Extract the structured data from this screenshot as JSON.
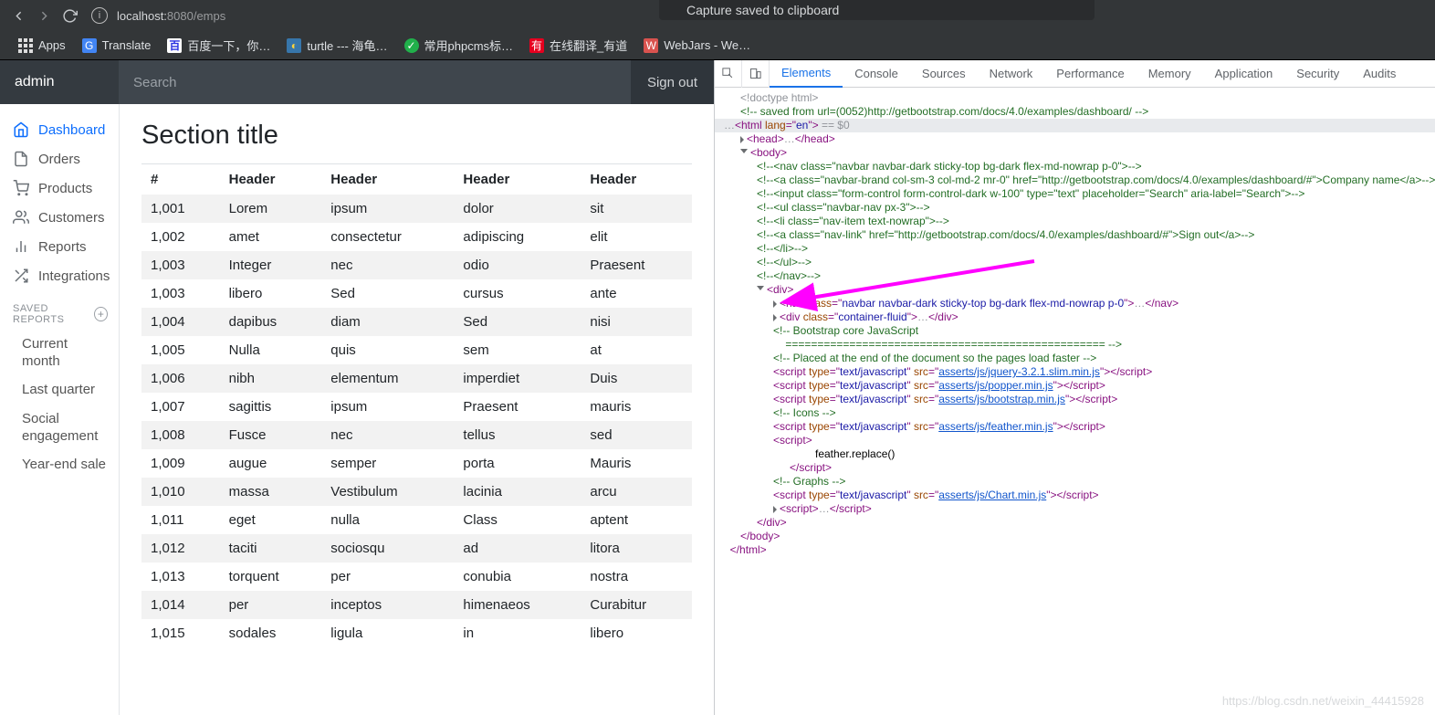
{
  "toast": "Capture saved to clipboard",
  "browser": {
    "host": "localhost:",
    "port": "8080",
    "path": "/emps",
    "bookmarks": [
      {
        "icon": "apps",
        "label": "Apps"
      },
      {
        "icon": "g",
        "label": "Translate"
      },
      {
        "icon": "baidu",
        "label": "百度一下，你…"
      },
      {
        "icon": "py",
        "label": "turtle --- 海龟…"
      },
      {
        "icon": "ok",
        "label": "常用phpcms标…"
      },
      {
        "icon": "yd",
        "label": "在线翻译_有道"
      },
      {
        "icon": "wj",
        "label": "WebJars - We…"
      }
    ]
  },
  "page": {
    "brand": "admin",
    "search_placeholder": "Search",
    "signout": "Sign out",
    "nav": [
      {
        "label": "Dashboard"
      },
      {
        "label": "Orders"
      },
      {
        "label": "Products"
      },
      {
        "label": "Customers"
      },
      {
        "label": "Reports"
      },
      {
        "label": "Integrations"
      }
    ],
    "saved_header": "SAVED REPORTS",
    "saved": [
      {
        "label": "Current month"
      },
      {
        "label": "Last quarter"
      },
      {
        "label": "Social engagement"
      },
      {
        "label": "Year-end sale"
      }
    ],
    "title": "Section title",
    "headers": [
      "#",
      "Header",
      "Header",
      "Header",
      "Header"
    ],
    "rows": [
      [
        "1,001",
        "Lorem",
        "ipsum",
        "dolor",
        "sit"
      ],
      [
        "1,002",
        "amet",
        "consectetur",
        "adipiscing",
        "elit"
      ],
      [
        "1,003",
        "Integer",
        "nec",
        "odio",
        "Praesent"
      ],
      [
        "1,003",
        "libero",
        "Sed",
        "cursus",
        "ante"
      ],
      [
        "1,004",
        "dapibus",
        "diam",
        "Sed",
        "nisi"
      ],
      [
        "1,005",
        "Nulla",
        "quis",
        "sem",
        "at"
      ],
      [
        "1,006",
        "nibh",
        "elementum",
        "imperdiet",
        "Duis"
      ],
      [
        "1,007",
        "sagittis",
        "ipsum",
        "Praesent",
        "mauris"
      ],
      [
        "1,008",
        "Fusce",
        "nec",
        "tellus",
        "sed"
      ],
      [
        "1,009",
        "augue",
        "semper",
        "porta",
        "Mauris"
      ],
      [
        "1,010",
        "massa",
        "Vestibulum",
        "lacinia",
        "arcu"
      ],
      [
        "1,011",
        "eget",
        "nulla",
        "Class",
        "aptent"
      ],
      [
        "1,012",
        "taciti",
        "sociosqu",
        "ad",
        "litora"
      ],
      [
        "1,013",
        "torquent",
        "per",
        "conubia",
        "nostra"
      ],
      [
        "1,014",
        "per",
        "inceptos",
        "himenaeos",
        "Curabitur"
      ],
      [
        "1,015",
        "sodales",
        "ligula",
        "in",
        "libero"
      ]
    ]
  },
  "devtools": {
    "tabs": [
      "Elements",
      "Console",
      "Sources",
      "Network",
      "Performance",
      "Memory",
      "Application",
      "Security",
      "Audits"
    ],
    "doctype": "<!doctype html>",
    "saved_cmt": "<!-- saved from url=(0052)http://getbootstrap.com/docs/4.0/examples/dashboard/ -->",
    "html_open_lang": "en",
    "sel_hint": " == $0",
    "comments": [
      "<!--<nav class=\"navbar navbar-dark sticky-top bg-dark flex-md-nowrap p-0\">-->",
      "<!--<a class=\"navbar-brand col-sm-3 col-md-2 mr-0\" href=\"http://getbootstrap.com/docs/4.0/examples/dashboard/#\">Company name</a>-->",
      "<!--<input class=\"form-control form-control-dark w-100\" type=\"text\" placeholder=\"Search\" aria-label=\"Search\">-->",
      "<!--<ul class=\"navbar-nav px-3\">-->",
      "<!--<li class=\"nav-item text-nowrap\">-->",
      "<!--<a class=\"nav-link\" href=\"http://getbootstrap.com/docs/4.0/examples/dashboard/#\">Sign out</a>-->",
      "<!--</li>-->",
      "<!--</ul>-->",
      "<!--</nav>-->"
    ],
    "nav_line": {
      "cls": "navbar navbar-dark sticky-top bg-dark flex-md-nowrap p-0"
    },
    "container_cls": "container-fluid",
    "core_cmt1": "<!-- Bootstrap core JavaScript",
    "core_cmt1b": "    ================================================== -->",
    "core_cmt2": "<!-- Placed at the end of the document so the pages load faster -->",
    "scripts": [
      "asserts/js/jquery-3.2.1.slim.min.js",
      "asserts/js/popper.min.js",
      "asserts/js/bootstrap.min.js"
    ],
    "icons_cmt": "<!-- Icons -->",
    "feather_src": "asserts/js/feather.min.js",
    "feather_call": "feather.replace()",
    "graphs_cmt": "<!-- Graphs -->",
    "chart_src": "asserts/js/Chart.min.js"
  },
  "watermark": "https://blog.csdn.net/weixin_44415928"
}
